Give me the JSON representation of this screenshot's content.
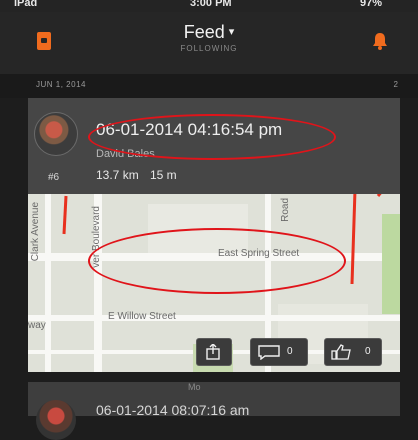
{
  "status": {
    "device": "iPad",
    "time": "3:00 PM",
    "battery": "97%"
  },
  "nav": {
    "title": "Feed",
    "title_chevron": "▾",
    "subtitle": "FOLLOWING"
  },
  "date_header": {
    "date": "JUN 1, 2014",
    "count": "2"
  },
  "activity": {
    "time": "06-01-2014 04:16:54 pm",
    "athlete": "David Bales",
    "rank": "#6",
    "distance": "13.7 km",
    "elevation": "15 m"
  },
  "map": {
    "streets": {
      "clark": "Clark Avenue",
      "boulevard": "ver Boulevard",
      "road": "Road",
      "east_spring": "East Spring Street",
      "willow": "E Willow Street",
      "way": "way"
    }
  },
  "actions": {
    "comments": "0",
    "kudos": "0"
  },
  "next_activity": {
    "time": "06-01-2014 08:07:16 am",
    "partial": "Mo"
  },
  "colors": {
    "accent": "#f06b1e",
    "route": "#e8301e",
    "annotation": "#e0141a"
  }
}
